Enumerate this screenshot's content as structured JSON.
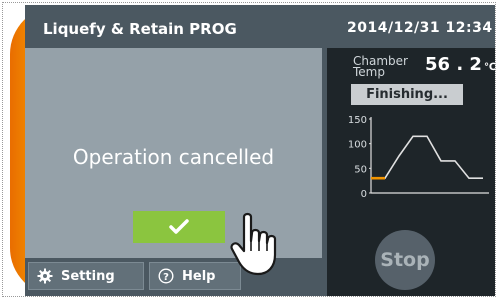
{
  "header": {
    "title": "Liquefy & Retain PROG",
    "datetime": "2014/12/31 12:34"
  },
  "dialog": {
    "message": "Operation cancelled",
    "ok_icon": "check-icon"
  },
  "footer": {
    "setting_label": "Setting",
    "setting_icon": "gear-icon",
    "help_label": "Help",
    "help_icon": "question-circle-icon"
  },
  "chamber": {
    "label": "Chamber Temp",
    "value": "56 . 2",
    "unit": "℃",
    "status": "Finishing..."
  },
  "chart_data": {
    "type": "line",
    "yticks": [
      "150",
      "100",
      "50",
      "0"
    ],
    "ylim": [
      0,
      150
    ],
    "x": [
      0,
      1,
      2,
      3,
      4,
      5,
      6,
      7,
      8
    ],
    "values": [
      30,
      30,
      75,
      115,
      115,
      65,
      65,
      30,
      30
    ],
    "elapsed_until_x": 1,
    "colors": {
      "line": "#e0e0e0",
      "elapsed": "#f29400",
      "axis": "#e0e0e0"
    }
  },
  "controls": {
    "stop_label": "Stop"
  },
  "colors": {
    "accent_orange": "#f28c00",
    "confirm_green": "#8bc53f",
    "screen_bg": "#4b5861"
  }
}
